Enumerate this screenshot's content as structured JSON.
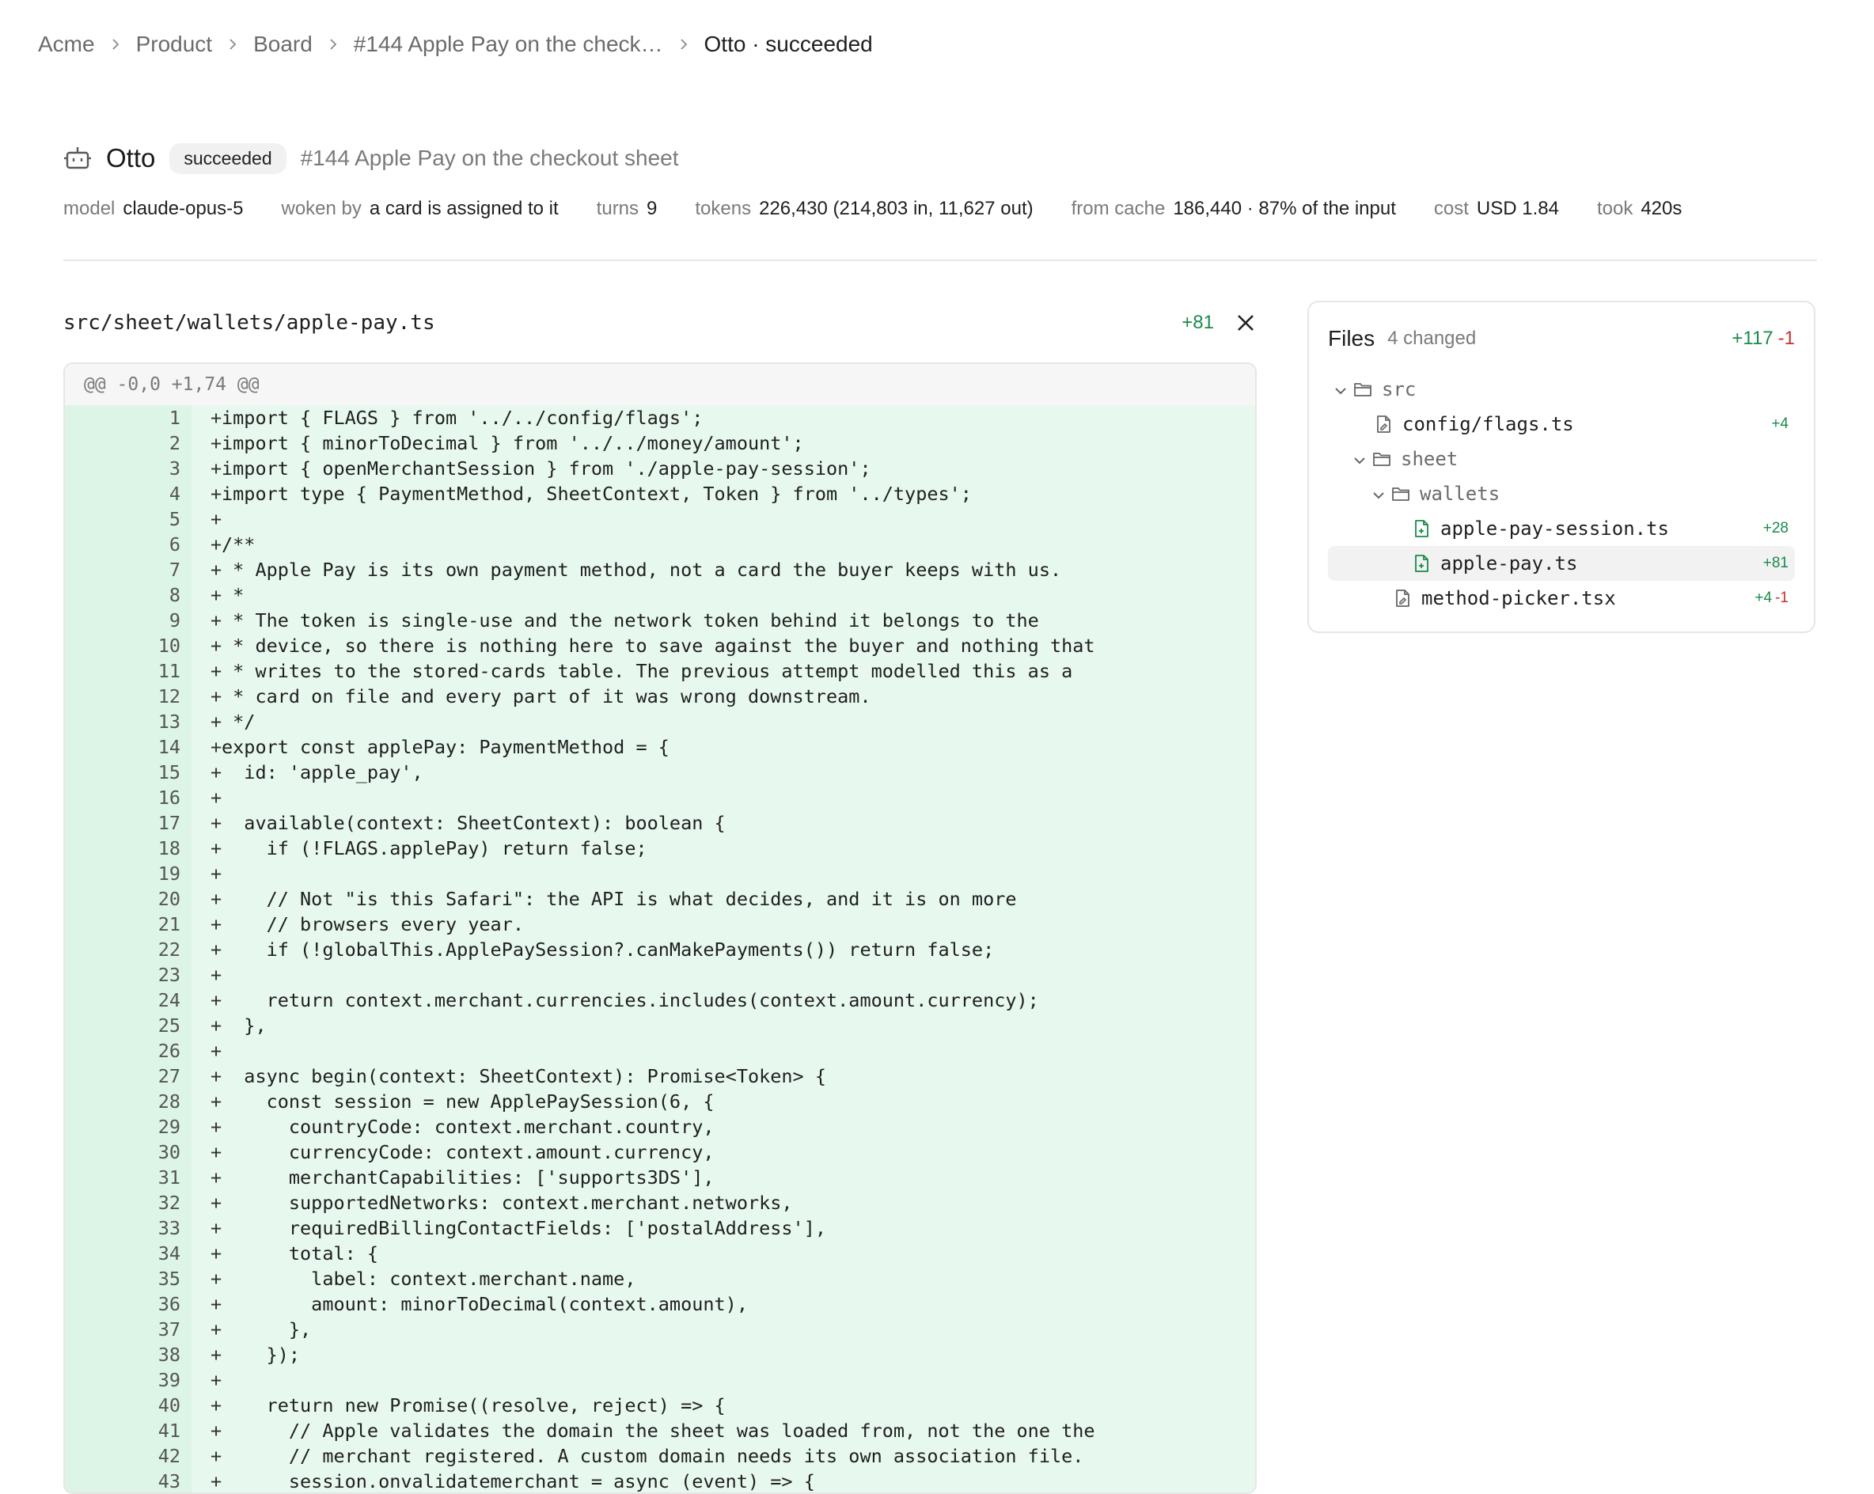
{
  "breadcrumb": [
    "Acme",
    "Product",
    "Board",
    "#144 Apple Pay on the check…",
    "Otto · succeeded"
  ],
  "header": {
    "title": "Otto",
    "status": "succeeded",
    "subtitle": "#144 Apple Pay on the checkout sheet"
  },
  "stats": [
    {
      "key": "model",
      "value": "claude-opus-5"
    },
    {
      "key": "woken by",
      "value": "a card is assigned to it"
    },
    {
      "key": "turns",
      "value": "9"
    },
    {
      "key": "tokens",
      "value": "226,430 (214,803 in, 11,627 out)"
    },
    {
      "key": "from cache",
      "value": "186,440 · 87% of the input"
    },
    {
      "key": "cost",
      "value": "USD 1.84"
    },
    {
      "key": "took",
      "value": "420s"
    }
  ],
  "diff": {
    "path": "src/sheet/wallets/apple-pay.ts",
    "additions": "+81",
    "hunk": "@@ -0,0 +1,74 @@",
    "lines": [
      "import { FLAGS } from '../../config/flags';",
      "import { minorToDecimal } from '../../money/amount';",
      "import { openMerchantSession } from './apple-pay-session';",
      "import type { PaymentMethod, SheetContext, Token } from '../types';",
      "",
      "/**",
      " * Apple Pay is its own payment method, not a card the buyer keeps with us.",
      " *",
      " * The token is single-use and the network token behind it belongs to the",
      " * device, so there is nothing here to save against the buyer and nothing that",
      " * writes to the stored-cards table. The previous attempt modelled this as a",
      " * card on file and every part of it was wrong downstream.",
      " */",
      "export const applePay: PaymentMethod = {",
      "  id: 'apple_pay',",
      "",
      "  available(context: SheetContext): boolean {",
      "    if (!FLAGS.applePay) return false;",
      "",
      "    // Not \"is this Safari\": the API is what decides, and it is on more",
      "    // browsers every year.",
      "    if (!globalThis.ApplePaySession?.canMakePayments()) return false;",
      "",
      "    return context.merchant.currencies.includes(context.amount.currency);",
      "  },",
      "",
      "  async begin(context: SheetContext): Promise<Token> {",
      "    const session = new ApplePaySession(6, {",
      "      countryCode: context.merchant.country,",
      "      currencyCode: context.amount.currency,",
      "      merchantCapabilities: ['supports3DS'],",
      "      supportedNetworks: context.merchant.networks,",
      "      requiredBillingContactFields: ['postalAddress'],",
      "      total: {",
      "        label: context.merchant.name,",
      "        amount: minorToDecimal(context.amount),",
      "      },",
      "    });",
      "",
      "    return new Promise((resolve, reject) => {",
      "      // Apple validates the domain the sheet was loaded from, not the one the",
      "      // merchant registered. A custom domain needs its own association file.",
      "      session.onvalidatemerchant = async (event) => {"
    ]
  },
  "files_panel": {
    "title": "Files",
    "count": "4 changed",
    "additions": "+117",
    "deletions": "-1",
    "tree": [
      {
        "name": "src",
        "type": "folder",
        "depth": 0,
        "expanded": true,
        "add": "",
        "del": ""
      },
      {
        "name": "config/flags.ts",
        "type": "file",
        "depth": 1,
        "icon": "file-modified",
        "add": "+4",
        "del": ""
      },
      {
        "name": "sheet",
        "type": "folder",
        "depth": 1,
        "expanded": true,
        "add": "",
        "del": ""
      },
      {
        "name": "wallets",
        "type": "folder",
        "depth": 2,
        "expanded": true,
        "add": "",
        "del": ""
      },
      {
        "name": "apple-pay-session.ts",
        "type": "file",
        "depth": 3,
        "icon": "file-added",
        "add": "+28",
        "del": ""
      },
      {
        "name": "apple-pay.ts",
        "type": "file",
        "depth": 3,
        "icon": "file-added",
        "add": "+81",
        "del": "",
        "selected": true
      },
      {
        "name": "method-picker.tsx",
        "type": "file",
        "depth": 2,
        "icon": "file-modified",
        "add": "+4",
        "del": "-1"
      }
    ]
  },
  "colors": {
    "added_bg": "#e7f8ef",
    "added_text": "#1a8a4a",
    "deleted_text": "#c9302c"
  }
}
